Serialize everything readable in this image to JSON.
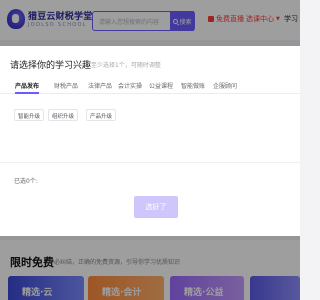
{
  "header": {
    "logo_title": "猎豆云财税学堂",
    "logo_sub": "JOOLSO SCHOOL",
    "search_placeholder": "请输入您想搜索的内容",
    "search_button": "搜索",
    "nav": [
      {
        "label": "免费直播",
        "icon": "live-icon"
      },
      {
        "label": "选课中心",
        "icon": "course-icon"
      },
      {
        "label": "学习"
      }
    ]
  },
  "modal": {
    "title": "请选择你的学习兴趣",
    "hint": "至少选择1个，可随时调整",
    "tabs": [
      "产品发布",
      "财税产品",
      "法律产品",
      "会计实操",
      "公益课程",
      "智能做账",
      "企服顾问"
    ],
    "active_tab_index": 0,
    "tags": [
      "智能升级",
      "组织升级",
      "产品升级"
    ],
    "selected_label": "已选0个:",
    "submit_label": "选好了"
  },
  "limited": {
    "title": "限时免费",
    "subtitle": "不必纠结，正确的免费资源，引导你学习优质知识",
    "cards": [
      "精选·云",
      "精选·会计",
      "精选·公益",
      ""
    ]
  },
  "colors": {
    "accent": "#6b5cff",
    "submit_disabled": "#cfc7fb",
    "nav_red": "#ff3b3b"
  }
}
